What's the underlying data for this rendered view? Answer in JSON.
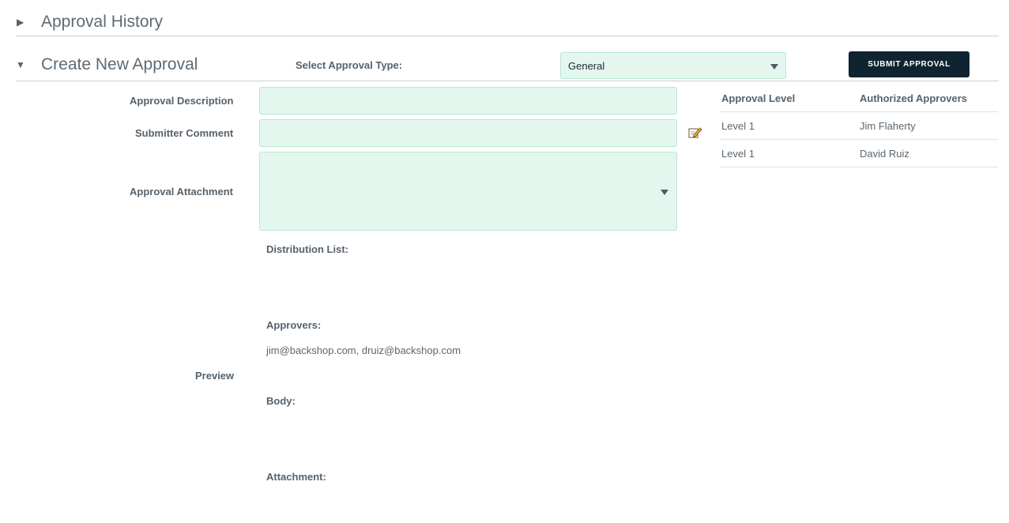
{
  "history": {
    "title": "Approval History",
    "toggle": "▶"
  },
  "create": {
    "title": "Create New Approval",
    "toggle": "▼"
  },
  "approval_type": {
    "label": "Select Approval Type:",
    "selected": "General"
  },
  "submit": {
    "label": "SUBMIT APPROVAL"
  },
  "form": {
    "description_label": "Approval Description",
    "comment_label": "Submitter Comment",
    "attachment_label": "Approval Attachment",
    "preview_label": "Preview"
  },
  "preview": {
    "distribution_label": "Distribution List:",
    "approvers_label": "Approvers:",
    "approvers_value": "jim@backshop.com, druiz@backshop.com",
    "body_label": "Body:",
    "attachment_label": "Attachment:"
  },
  "approvers_table": {
    "headers": [
      "Approval Level",
      "Authorized Approvers"
    ],
    "rows": [
      {
        "level": "Level 1",
        "approver": "Jim Flaherty"
      },
      {
        "level": "Level 1",
        "approver": "David Ruiz"
      }
    ]
  },
  "icons": {
    "edit": "edit-pencil-icon"
  },
  "colors": {
    "field_bg": "#e3f7ef",
    "button_bg": "#0f2431"
  }
}
